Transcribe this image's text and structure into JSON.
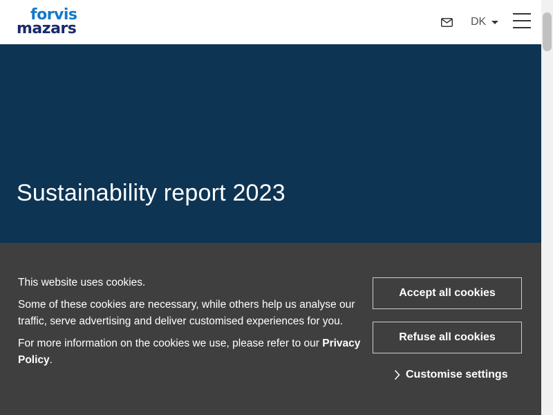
{
  "header": {
    "logo_line1": "forvis",
    "logo_line2": "mazars",
    "mail_icon": "mail-icon",
    "language": "DK",
    "menu_icon": "hamburger-menu-icon"
  },
  "hero": {
    "title": "Sustainability report 2023",
    "background_color": "#0e3453"
  },
  "cookie_banner": {
    "heading": "This website uses cookies.",
    "body": "Some of these cookies are necessary, while others help us analyse our traffic, serve advertising and deliver customised experiences for you.",
    "info_prefix": "For more information on the cookies we use, please refer to our ",
    "privacy_link": "Privacy Policy",
    "info_suffix": ".",
    "accept_label": "Accept all cookies",
    "refuse_label": "Refuse all cookies",
    "customise_label": "Customise settings",
    "background_color": "#3f3f3f"
  }
}
